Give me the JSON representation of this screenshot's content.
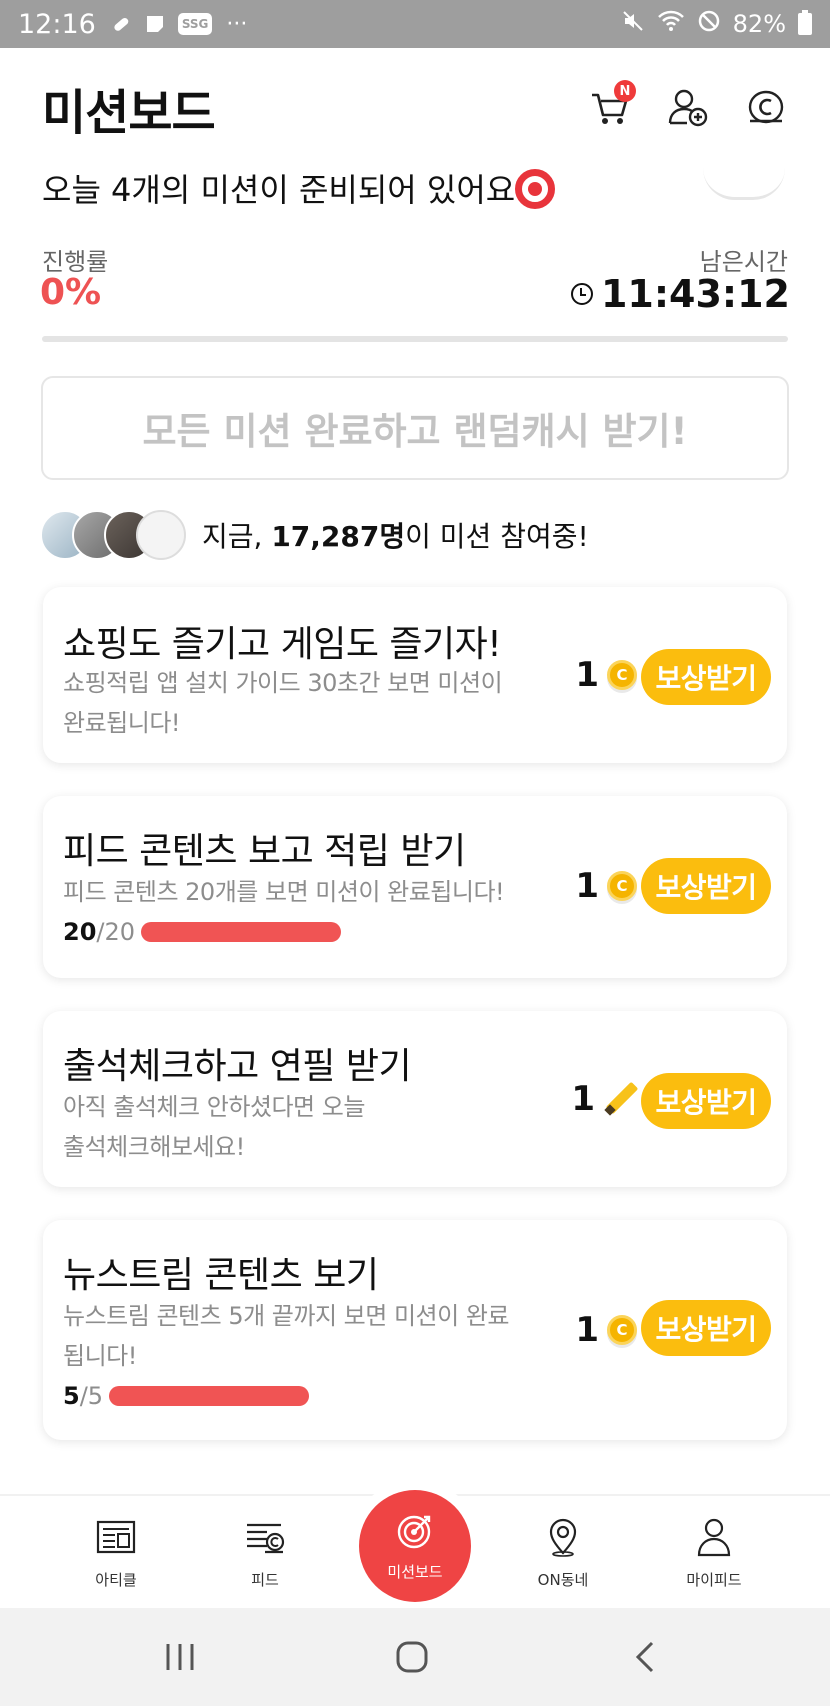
{
  "status_bar": {
    "time": "12:16",
    "ssg": "SSG",
    "more": "···",
    "battery": "82%"
  },
  "header": {
    "title": "미션보드",
    "cart_badge": "N"
  },
  "summary": {
    "intro_text": "오늘 4개의 미션이 준비되어 있어요",
    "progress_label": "진행률",
    "progress_value": "0%",
    "progress_fraction": 0,
    "remaining_label": "남은시간",
    "remaining_time": "11:43:12"
  },
  "all_complete_button": "모든 미션 완료하고 랜덤캐시 받기!",
  "participants": {
    "prefix": "지금, ",
    "count": "17,287명",
    "suffix": "이 미션 참여중!"
  },
  "missions": [
    {
      "title": "쇼핑도 즐기고 게임도 즐기자!",
      "desc": "쇼핑적립 앱 설치 가이드 30초간 보면 미션이 완료됩니다!",
      "reward": "1",
      "reward_icon": "coin-icon",
      "button": "보상받기"
    },
    {
      "title": "피드 콘텐츠 보고 적립 받기",
      "desc": "피드 콘텐츠 20개를 보면 미션이 완료됩니다!",
      "reward": "1",
      "reward_icon": "coin-icon",
      "button": "보상받기",
      "progress_done": "20",
      "progress_total": "/20"
    },
    {
      "title": "출석체크하고 연필 받기",
      "desc": "아직 출석체크 안하셨다면 오늘 출석체크해보세요!",
      "reward": "1",
      "reward_icon": "pencil-icon",
      "button": "보상받기"
    },
    {
      "title": "뉴스트림 콘텐츠 보기",
      "desc": "뉴스트림 콘텐츠 5개 끝까지 보면 미션이 완료됩니다!",
      "reward": "1",
      "reward_icon": "coin-icon",
      "button": "보상받기",
      "progress_done": "5",
      "progress_total": "/5"
    }
  ],
  "bottom_nav": {
    "article": "아티클",
    "feed": "피드",
    "missionboard": "미션보드",
    "on_neighborhood": "ON동네",
    "my_feed": "마이피드"
  },
  "colors": {
    "accent_red": "#ee5253",
    "reward_yellow": "#fbbd0e",
    "status_bar_gray": "#9e9e9e"
  }
}
